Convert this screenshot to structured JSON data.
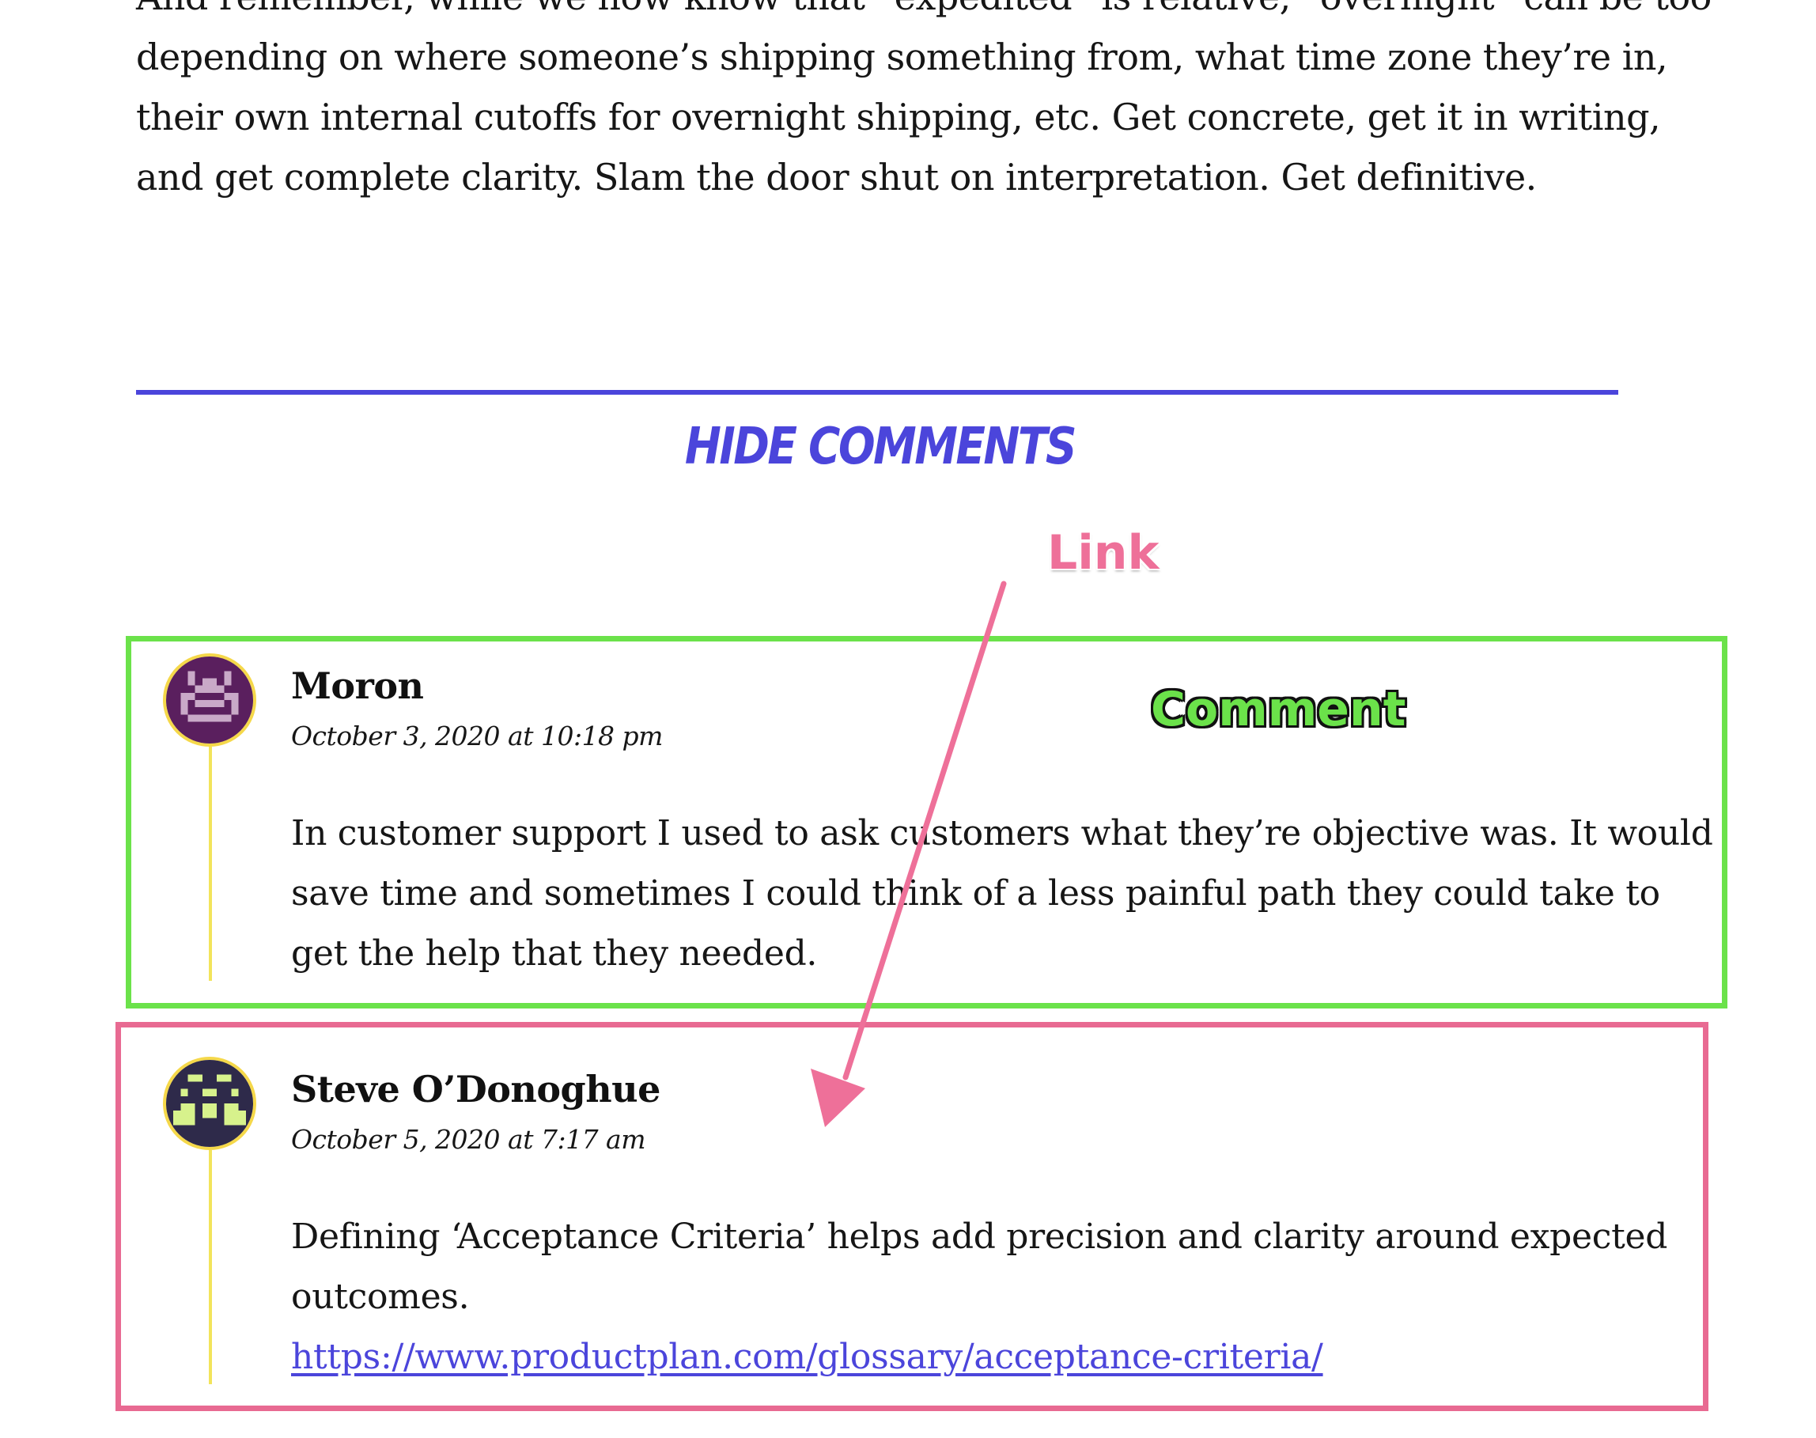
{
  "article": {
    "lines": [
      "And remember, while we now know that “expedited” is relative, “overnight” can be too",
      "depending on where someone’s shipping something from, what time zone they’re in,",
      "their own internal cutoffs for overnight shipping, etc. Get concrete, get it in writing,",
      "and get complete clarity. Slam the door shut on interpretation. Get definitive."
    ]
  },
  "comments_section": {
    "toggle_label": "HIDE COMMENTS"
  },
  "annotations": {
    "link_label": "Link",
    "comment_label": "Comment",
    "colors": {
      "link": "#EE7099",
      "comment": "#6BE24A"
    }
  },
  "comments": [
    {
      "author": "Moron",
      "date": "October 3, 2020 at 10:18 pm",
      "avatar": "purple-pixel-avatar-icon",
      "body_lines": [
        "In customer support I used to ask customers what they’re objective was. It would",
        "save time and sometimes I could think of a less painful path they could take to",
        "get the help that they needed."
      ]
    },
    {
      "author": "Steve O’Donoghue",
      "date": "October 5, 2020 at 7:17 am",
      "avatar": "navy-pixel-avatar-icon",
      "body_lines": [
        "Defining ‘Acceptance Criteria’ helps add precision and clarity around expected",
        "outcomes."
      ],
      "link": "https://www.productplan.com/glossary/acceptance-criteria/"
    }
  ],
  "colors": {
    "accent": "#4B45DB",
    "thread_line": "#F2E45B",
    "avatar_border": "#F5D84A"
  }
}
